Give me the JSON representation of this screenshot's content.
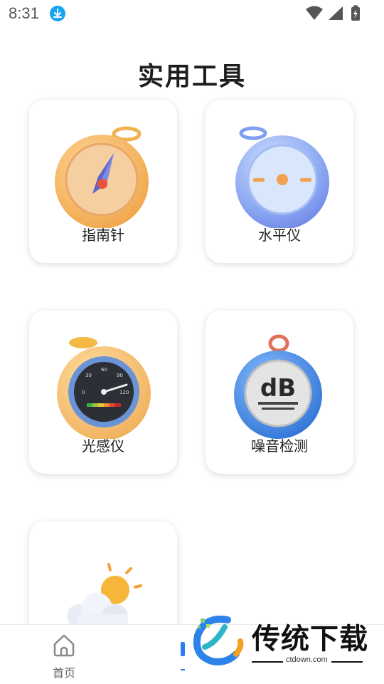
{
  "status_bar": {
    "time": "8:31",
    "icons": [
      "download-icon",
      "wifi-icon",
      "cellular-signal-icon",
      "battery-charging-icon"
    ]
  },
  "page": {
    "title": "实用工具"
  },
  "tools": [
    {
      "label": "指南针",
      "icon": "compass-icon"
    },
    {
      "label": "水平仪",
      "icon": "level-icon"
    },
    {
      "label": "光感仪",
      "icon": "light-meter-icon"
    },
    {
      "label": "噪音检测",
      "icon": "decibel-meter-icon",
      "icon_text": "dB"
    },
    {
      "label": "",
      "icon": "weather-icon"
    }
  ],
  "gauge_ticks": [
    "30",
    "60",
    "90",
    "0",
    "120"
  ],
  "bottom_nav": {
    "home_label": "首页"
  },
  "watermark": {
    "brand": "传统下载",
    "domain": "ctdown.com"
  },
  "colors": {
    "accent": "#1aa3f0",
    "nav_active": "#2a7df4"
  }
}
